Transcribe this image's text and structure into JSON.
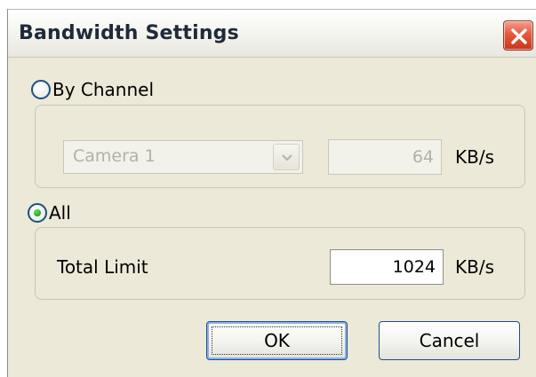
{
  "window": {
    "title": "Bandwidth Settings",
    "close_icon": "close-icon"
  },
  "by_channel": {
    "label": "By Channel",
    "selected": false,
    "camera_select": {
      "value": "Camera 1",
      "enabled": false
    },
    "rate_value": "64",
    "rate_unit": "KB/s"
  },
  "all": {
    "label": "All",
    "selected": true,
    "total_limit_label": "Total Limit",
    "total_limit_value": "1024",
    "total_limit_unit": "KB/s"
  },
  "buttons": {
    "ok_label": "OK",
    "cancel_label": "Cancel"
  }
}
